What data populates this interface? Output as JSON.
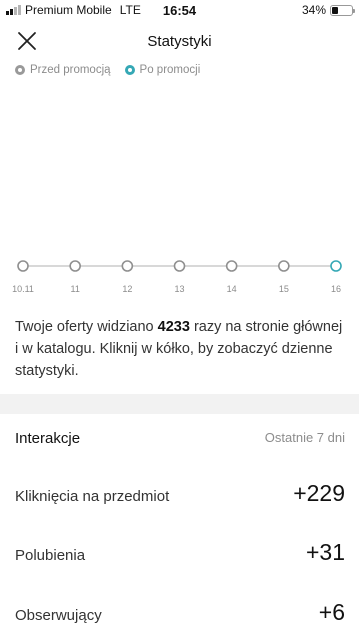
{
  "status_bar": {
    "carrier": "Premium Mobile",
    "network": "LTE",
    "time": "16:54",
    "battery": "34%",
    "battery_level": 0.34
  },
  "nav": {
    "title": "Statystyki",
    "close_icon": "close-icon"
  },
  "legend": {
    "items": [
      {
        "label": "Przed promocją",
        "color": "#999999"
      },
      {
        "label": "Po promocji",
        "color": "#35a8b5"
      }
    ]
  },
  "chart_data": {
    "type": "line",
    "x": [
      "10.11",
      "11",
      "12",
      "13",
      "14",
      "15",
      "16"
    ],
    "highlighted_index": 6,
    "colors": {
      "line": "#b0b0b0",
      "point": "#8f8f8f",
      "active_point": "#35a8b5"
    }
  },
  "description": {
    "before": "Twoje oferty widziano ",
    "count": "4233",
    "after": " razy na stronie głównej i w katalogu. Kliknij w kółko, by zobaczyć dzienne statystyki."
  },
  "interactions": {
    "title": "Interakcje",
    "period": "Ostatnie 7 dni",
    "rows": [
      {
        "label": "Kliknięcia na przedmiot",
        "value": "+229"
      },
      {
        "label": "Polubienia",
        "value": "+31"
      },
      {
        "label": "Obserwujący",
        "value": "+6"
      }
    ]
  }
}
